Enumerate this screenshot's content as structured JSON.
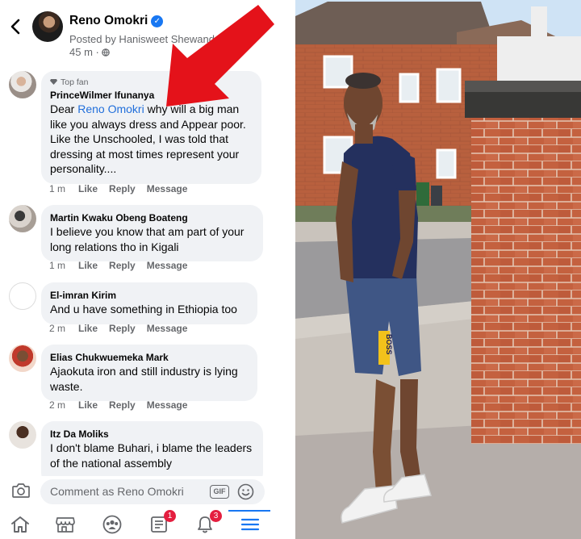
{
  "post": {
    "author": "Reno Omokri",
    "posted_by": "Posted by Hanisweet Shewandagn",
    "time": "45 m ·"
  },
  "comments": [
    {
      "badge": "Top fan",
      "name": "PrinceWilmer Ifunanya",
      "text_pre": "Dear ",
      "mention": "Reno Omokri",
      "text_post": " why will a big man like you always dress and Appear poor. Like the Unschooled, I was told that dressing at most times represent your personality....",
      "time": "1 m",
      "like": "Like",
      "reply": "Reply",
      "message": "Message"
    },
    {
      "name": "Martin Kwaku Obeng Boateng",
      "text": "I believe you know that am part of your long relations tho in Kigali",
      "time": "1 m",
      "like": "Like",
      "reply": "Reply",
      "message": "Message"
    },
    {
      "name": "El-imran Kirim",
      "text": "And  u have something in Ethiopia too",
      "time": "2 m",
      "like": "Like",
      "reply": "Reply",
      "message": "Message"
    },
    {
      "name": "Elias Chukwuemeka Mark",
      "text": "Ajaokuta iron and still industry is lying waste.",
      "time": "2 m",
      "like": "Like",
      "reply": "Reply",
      "message": "Message"
    },
    {
      "name": "Itz Da Moliks",
      "text": "I don't blame Buhari, i blame the leaders of the national assembly"
    }
  ],
  "composer": {
    "placeholder": "Comment as Reno Omokri",
    "gif": "GIF"
  },
  "tabs": {
    "items": [
      "home-icon",
      "marketplace-icon",
      "groups-icon",
      "news-icon",
      "bell-icon",
      "menu-icon"
    ],
    "news_badge": "1",
    "notifications_badge": "3"
  },
  "photo": {
    "shorts_text": "BOSS"
  },
  "colors": {
    "accent": "#1877f2",
    "mention": "#216fdb",
    "bubble": "#f0f2f5",
    "arrow": "#e4121a",
    "badge": "#e41e3f"
  }
}
